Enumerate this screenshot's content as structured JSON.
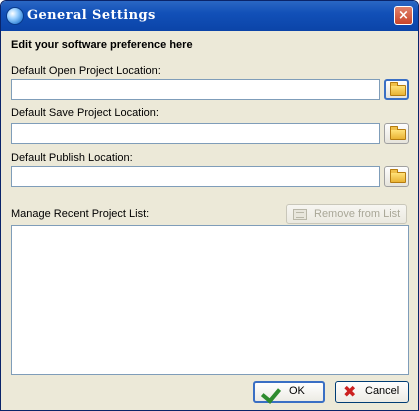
{
  "window": {
    "title": "General Settings",
    "close_glyph": "×"
  },
  "form": {
    "heading": "Edit your software preference here",
    "open_location_label": "Default Open Project Location:",
    "open_location_value": "",
    "save_location_label": "Default Save Project Location:",
    "save_location_value": "",
    "publish_location_label": "Default Publish Location:",
    "publish_location_value": "",
    "recent_list_label": "Manage Recent Project List:",
    "remove_label": "Remove from List",
    "recent_projects": []
  },
  "footer": {
    "ok_label": "OK",
    "cancel_label": "Cancel"
  },
  "icons": {
    "browse": "folder-icon",
    "ok": "checkmark-icon",
    "cancel": "cross-icon",
    "remove": "remove-list-icon",
    "title": "globe-icon"
  },
  "colors": {
    "titlebar": "#0b44a8",
    "dialog_background": "#ece9d8",
    "field_border": "#7f9db9",
    "focus_border": "#3a6fc4"
  }
}
